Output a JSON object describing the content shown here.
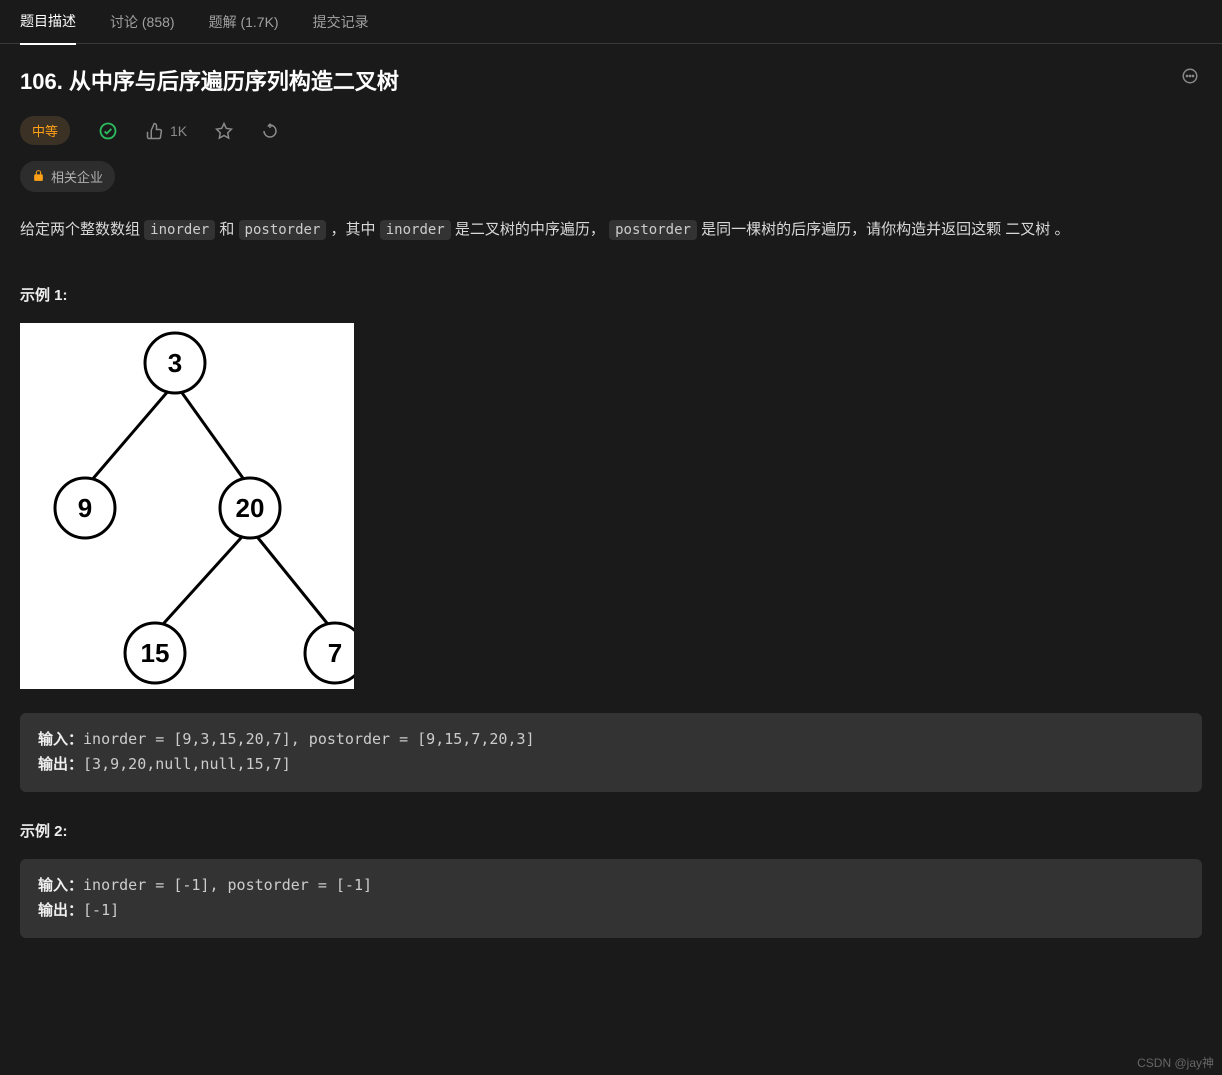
{
  "tabs": [
    {
      "label": "题目描述",
      "active": true
    },
    {
      "label": "讨论 (858)",
      "active": false
    },
    {
      "label": "题解 (1.7K)",
      "active": false
    },
    {
      "label": "提交记录",
      "active": false
    }
  ],
  "title": "106. 从中序与后序遍历序列构造二叉树",
  "difficulty": "中等",
  "likes": "1K",
  "company_label": "相关企业",
  "desc": {
    "p1a": "给定两个整数数组 ",
    "c1": "inorder",
    "p1b": " 和 ",
    "c2": "postorder",
    "p1c": " ，其中 ",
    "c3": "inorder",
    "p1d": " 是二叉树的中序遍历， ",
    "c4": "postorder",
    "p1e": " 是同一棵树的后序遍历，请你构造并返回这颗 二叉树 。"
  },
  "example1": {
    "label": "示例 1:",
    "input_label": "输入：",
    "input_value": "inorder = [9,3,15,20,7], postorder = [9,15,7,20,3]",
    "output_label": "输出：",
    "output_value": "[3,9,20,null,null,15,7]"
  },
  "example2": {
    "label": "示例 2:",
    "input_label": "输入：",
    "input_value": "inorder = [-1], postorder = [-1]",
    "output_label": "输出：",
    "output_value": "[-1]"
  },
  "tree": {
    "nodes": [
      "3",
      "9",
      "20",
      "15",
      "7"
    ]
  },
  "watermark": "CSDN @jay神"
}
